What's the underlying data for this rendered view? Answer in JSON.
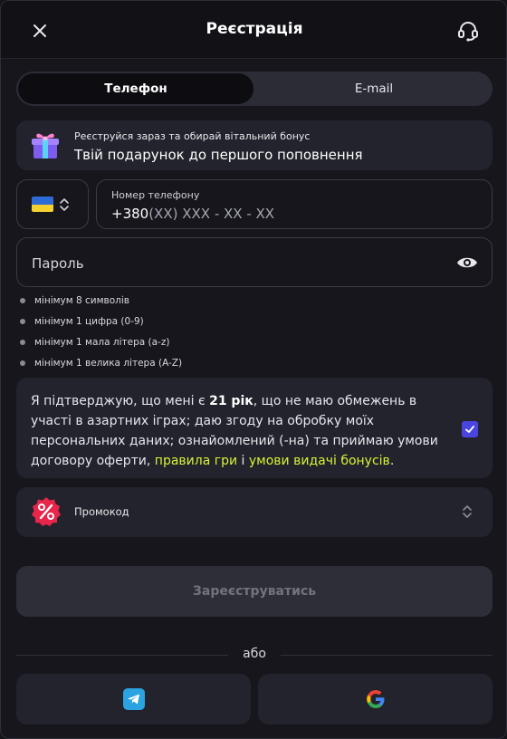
{
  "header": {
    "title": "Реєстрація",
    "close_icon": "close-icon",
    "support_icon": "headset-support-icon"
  },
  "tabs": [
    {
      "label": "Телефон",
      "active": true
    },
    {
      "label": "E-mail",
      "active": false
    }
  ],
  "bonus": {
    "icon": "gift-icon",
    "subtitle": "Реєструйся зараз та обирай вітальний бонус",
    "title": "Твій подарунок до першого поповнення"
  },
  "phone": {
    "country_flag": "ukraine-flag-icon",
    "label": "Номер телефону",
    "code": "+380",
    "mask": "(XX) XXX - XX - XX"
  },
  "password": {
    "placeholder": "Пароль",
    "toggle_icon": "eye-icon"
  },
  "password_rules": [
    "мінімум 8 символів",
    "мінімум 1 цифра (0-9)",
    "мінімум 1 мала літера (a-z)",
    "мінімум 1 велика літера (A-Z)"
  ],
  "consent": {
    "text_1": "Я підтверджую, що мені є ",
    "age": "21 рік",
    "text_2": ", що не маю обмежень в участі в азартних іграх; даю згоду на обробку моїх персональних даних; ознайомлений (-на) та приймаю умови договору оферти, ",
    "link_1": "правила гри",
    "text_3": " і ",
    "link_2": "умови видачі бонусів",
    "text_4": ".",
    "checked": true
  },
  "promo": {
    "icon": "percent-badge-icon",
    "label": "Промокод"
  },
  "submit_label": "Зареєструватись",
  "or_label": "або",
  "social": [
    {
      "name": "telegram",
      "icon": "telegram-icon"
    },
    {
      "name": "google",
      "icon": "google-icon"
    }
  ],
  "colors": {
    "background": "#16161c",
    "panel": "#22232c",
    "accent_link": "#d7f337",
    "checkbox": "#4a45e0"
  }
}
